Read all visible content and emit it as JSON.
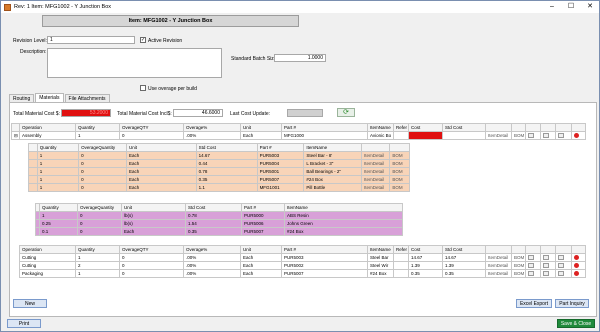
{
  "window": {
    "title": "Rev: 1 Item: MFG1002 - Y Junction Box"
  },
  "header": {
    "title": "Item: MFG1002 - Y Junction Box"
  },
  "form": {
    "revision_label": "Revision Level:",
    "revision_value": "1",
    "active_revision_label": "Active Revision",
    "description_label": "Description:",
    "batch_label": "Standard Batch Size:",
    "batch_value": "1.0000",
    "use_average_label": "Use overage per build"
  },
  "tabs": [
    {
      "label": "Routing"
    },
    {
      "label": "Materials"
    },
    {
      "label": "File Attachments"
    }
  ],
  "costs": {
    "total_label": "Total Material Cost $:",
    "total_value": "53.2000",
    "total_inc_label": "Total Material Cost Incl$:",
    "total_inc_value": "46.6000",
    "last_update_label": "Last Cost Update:"
  },
  "main_headers": [
    "Operation",
    "Quantity",
    "OverageQTY",
    "Overage%",
    "Unit",
    "Part #",
    "ItemName",
    "Refer",
    "Cost",
    "Std Cost"
  ],
  "assembly_row": [
    "Assembly",
    "1",
    "0",
    ".00%",
    "Each",
    "MFG1000",
    "Avionic Bo",
    "",
    "",
    ""
  ],
  "sub_headers": [
    "Quantity",
    "OverageQuantity",
    "Unit",
    "Std Cost",
    "Part #",
    "ItemName"
  ],
  "sub_rows": [
    [
      "1",
      "0",
      "Each",
      "14.67",
      "PUR5003",
      "Steel Bar - 8'"
    ],
    [
      "1",
      "0",
      "Each",
      "0.44",
      "PUR5004",
      "L Bracket - 3\""
    ],
    [
      "1",
      "0",
      "Each",
      "0.78",
      "PUR5001",
      "Ball Bearings - 2\""
    ],
    [
      "1",
      "0",
      "Each",
      "0.35",
      "PUR5007",
      "#24 Box"
    ],
    [
      "1",
      "0",
      "Each",
      "1.1",
      "MFG1001",
      "Pill Bottle"
    ]
  ],
  "sub2_headers": [
    "Quantity",
    "OverageQuantity",
    "Unit",
    "Std Cost",
    "Part #",
    "ItemName"
  ],
  "sub2_rows": [
    [
      "1",
      "0",
      "lb(s)",
      "0.78",
      "PUR5000",
      "ABS Resin"
    ],
    [
      "0.25",
      "0",
      "lb(s)",
      "1.54",
      "PUR5006",
      "Johns Green"
    ],
    [
      "0.1",
      "0",
      "Each",
      "0.35",
      "PUR5007",
      "#24 Box"
    ]
  ],
  "ops_headers": [
    "Operation",
    "Quantity",
    "OverageQTY",
    "Overage%",
    "Unit",
    "Part #",
    "ItemName",
    "Refer",
    "Cost",
    "Std Cost"
  ],
  "ops_rows": [
    [
      "Cutting",
      "1",
      "0",
      ".00%",
      "Each",
      "PUR5003",
      "Steel Bar",
      "",
      "14.67",
      "14.67"
    ],
    [
      "Cutting",
      "2",
      "0",
      ".00%",
      "Each",
      "PUR5002",
      "Steel Wir",
      "",
      "1.39",
      "1.39"
    ],
    [
      "Packaging",
      "1",
      "0",
      ".00%",
      "Each",
      "PUR5007",
      "#24 Box",
      "",
      "0.35",
      "0.35"
    ]
  ],
  "row_buttons": {
    "item_detail": "ItemDetail",
    "bom": "BOM"
  },
  "buttons": {
    "new": "New",
    "excel_export": "Excel Export",
    "part_inquiry": "Part Inquiry",
    "print": "Print",
    "save_close": "Save & Close"
  }
}
